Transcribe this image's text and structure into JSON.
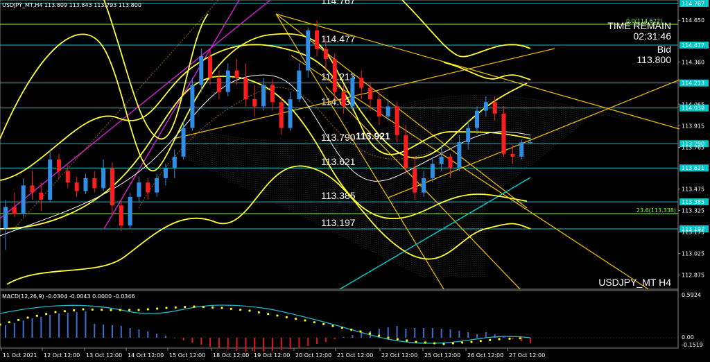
{
  "header": {
    "text": "USDJPY_MT,H4  113.809 113.843 113.793 113.800",
    "top_partial": "114.767"
  },
  "info": {
    "time_remain_label": "TIME REMAIN",
    "time_remain": "02:31:46",
    "bid_label": "Bid",
    "bid": "113.800",
    "watermark": "USDJPY_MT  H4",
    "current_marker": "113.921"
  },
  "price_axis": {
    "ticks": [
      "114.767",
      "114.650",
      "114.477",
      "114.360",
      "114.213",
      "114.065",
      "114.039",
      "113.915",
      "113.790",
      "113.765",
      "113.621",
      "113.475",
      "113.385",
      "113.325",
      "113.197",
      "113.175",
      "113.025",
      "112.875"
    ],
    "highlighted": [
      "114.767",
      "114.477",
      "114.213",
      "114.039",
      "113.790",
      "113.621",
      "113.385",
      "113.197"
    ]
  },
  "levels": [
    {
      "label": "114.477",
      "value": 114.477
    },
    {
      "label": "114.213",
      "value": 114.213
    },
    {
      "label": "114.039",
      "value": 114.039
    },
    {
      "label": "113.790",
      "value": 113.79
    },
    {
      "label": "113.621",
      "value": 113.621
    },
    {
      "label": "113.385",
      "value": 113.385
    },
    {
      "label": "113.197",
      "value": 113.197
    }
  ],
  "fib_labels": {
    "top": "0.0(114.622)",
    "mid": "23.6(113.338)"
  },
  "macd": {
    "label": "MACD(12,26,9) -0.0304 -0.0043 0.0000 -0.0346",
    "axis_top": "0.5924",
    "axis_zero": "0.00",
    "axis_bottom": "-0.1519"
  },
  "time_axis": {
    "labels": [
      "11 Oct 2021",
      "12 Oct 12:00",
      "13 Oct 12:00",
      "14 Oct 12:00",
      "15 Oct 12:00",
      "18 Oct 12:00",
      "19 Oct 12:00",
      "20 Oct 12:00",
      "21 Oct 12:00",
      "22 Oct 12:00",
      "25 Oct 12:00",
      "26 Oct 12:00",
      "27 Oct 12:00"
    ]
  },
  "colors": {
    "bull": "#2f8fe6",
    "bear": "#ff1e1e",
    "bollinger": "#ffff33",
    "trend": "#e6b800",
    "level": "#00c8c8",
    "fibo": "#7fff2a",
    "channel": "#cc22cc",
    "macd_line": "#22b8c8",
    "macd_signal": "#ffff00"
  },
  "chart_data": {
    "type": "candlestick",
    "symbol": "USDJPY_MT",
    "timeframe": "H4",
    "ylim": [
      112.8,
      114.8
    ],
    "candles": [
      [
        113.2,
        113.4,
        113.05,
        113.35
      ],
      [
        113.35,
        113.45,
        113.28,
        113.3
      ],
      [
        113.3,
        113.55,
        113.28,
        113.5
      ],
      [
        113.5,
        113.6,
        113.4,
        113.45
      ],
      [
        113.45,
        113.52,
        113.32,
        113.4
      ],
      [
        113.4,
        113.75,
        113.38,
        113.68
      ],
      [
        113.68,
        113.72,
        113.55,
        113.6
      ],
      [
        113.6,
        113.64,
        113.48,
        113.52
      ],
      [
        113.52,
        113.56,
        113.42,
        113.46
      ],
      [
        113.46,
        113.58,
        113.44,
        113.55
      ],
      [
        113.55,
        113.6,
        113.45,
        113.48
      ],
      [
        113.48,
        113.68,
        113.46,
        113.62
      ],
      [
        113.62,
        113.66,
        113.3,
        113.36
      ],
      [
        113.36,
        113.4,
        113.18,
        113.22
      ],
      [
        113.22,
        113.45,
        113.2,
        113.42
      ],
      [
        113.42,
        113.56,
        113.38,
        113.52
      ],
      [
        113.52,
        113.55,
        113.4,
        113.45
      ],
      [
        113.45,
        113.58,
        113.42,
        113.55
      ],
      [
        113.55,
        113.65,
        113.5,
        113.62
      ],
      [
        113.62,
        113.75,
        113.55,
        113.7
      ],
      [
        113.7,
        113.95,
        113.68,
        113.9
      ],
      [
        113.9,
        114.25,
        113.88,
        114.2
      ],
      [
        114.2,
        114.45,
        114.15,
        114.4
      ],
      [
        114.4,
        114.45,
        114.2,
        114.25
      ],
      [
        114.25,
        114.3,
        114.1,
        114.15
      ],
      [
        114.15,
        114.35,
        114.12,
        114.3
      ],
      [
        114.3,
        114.38,
        114.2,
        114.25
      ],
      [
        114.25,
        114.35,
        114.05,
        114.1
      ],
      [
        114.1,
        114.2,
        113.98,
        114.05
      ],
      [
        114.05,
        114.25,
        114.02,
        114.2
      ],
      [
        114.2,
        114.24,
        114.02,
        114.08
      ],
      [
        114.08,
        114.12,
        113.85,
        113.9
      ],
      [
        113.9,
        114.15,
        113.88,
        114.1
      ],
      [
        114.1,
        114.35,
        114.08,
        114.3
      ],
      [
        114.3,
        114.6,
        114.25,
        114.58
      ],
      [
        114.58,
        114.65,
        114.4,
        114.45
      ],
      [
        114.45,
        114.52,
        114.3,
        114.38
      ],
      [
        114.38,
        114.42,
        114.1,
        114.15
      ],
      [
        114.15,
        114.2,
        114.0,
        114.05
      ],
      [
        114.05,
        114.28,
        114.02,
        114.25
      ],
      [
        114.25,
        114.3,
        114.1,
        114.18
      ],
      [
        114.18,
        114.22,
        114.02,
        114.1
      ],
      [
        114.1,
        114.15,
        113.92,
        113.98
      ],
      [
        113.98,
        114.1,
        113.95,
        114.05
      ],
      [
        114.05,
        114.08,
        113.8,
        113.85
      ],
      [
        113.85,
        113.92,
        113.58,
        113.62
      ],
      [
        113.62,
        113.7,
        113.4,
        113.45
      ],
      [
        113.45,
        113.6,
        113.42,
        113.55
      ],
      [
        113.55,
        113.7,
        113.52,
        113.65
      ],
      [
        113.65,
        113.78,
        113.6,
        113.7
      ],
      [
        113.7,
        113.72,
        113.55,
        113.62
      ],
      [
        113.62,
        113.85,
        113.6,
        113.8
      ],
      [
        113.8,
        113.95,
        113.75,
        113.9
      ],
      [
        113.9,
        114.05,
        113.86,
        114.02
      ],
      [
        114.02,
        114.12,
        113.98,
        114.08
      ],
      [
        114.08,
        114.12,
        113.95,
        114.0
      ],
      [
        114.0,
        114.05,
        113.7,
        113.72
      ],
      [
        113.72,
        113.78,
        113.65,
        113.7
      ],
      [
        113.7,
        113.82,
        113.68,
        113.8
      ],
      [
        113.8,
        113.84,
        113.79,
        113.8
      ]
    ]
  }
}
